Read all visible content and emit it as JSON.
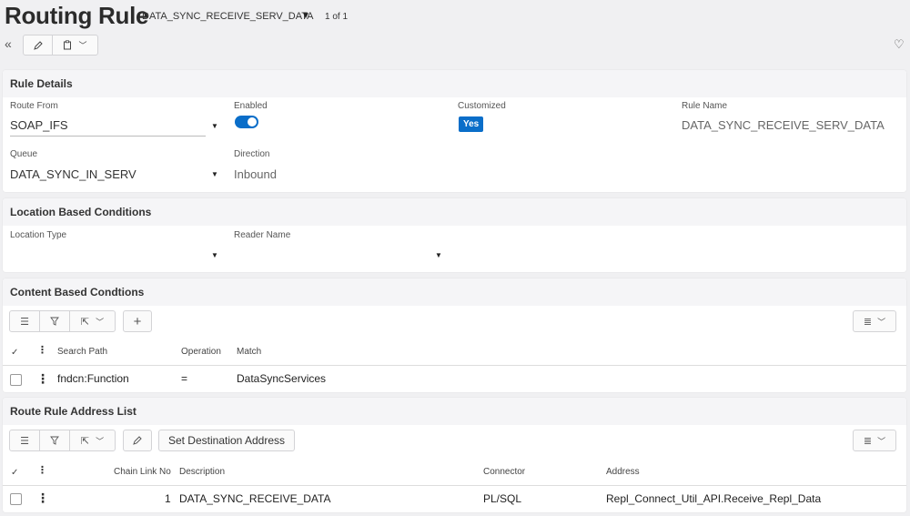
{
  "header": {
    "title": "Routing Rule",
    "record": "DATA_SYNC_RECEIVE_SERV_DATA",
    "count": "1 of 1"
  },
  "rule_details": {
    "heading": "Rule Details",
    "route_from": {
      "label": "Route From",
      "value": "SOAP_IFS"
    },
    "enabled": {
      "label": "Enabled",
      "on": true
    },
    "customized": {
      "label": "Customized",
      "value": "Yes"
    },
    "rule_name": {
      "label": "Rule Name",
      "value": "DATA_SYNC_RECEIVE_SERV_DATA"
    },
    "queue": {
      "label": "Queue",
      "value": "DATA_SYNC_IN_SERV"
    },
    "direction": {
      "label": "Direction",
      "value": "Inbound"
    }
  },
  "location_conditions": {
    "heading": "Location Based Conditions",
    "location_type_label": "Location Type",
    "reader_name_label": "Reader Name"
  },
  "content_conditions": {
    "heading": "Content Based Condtions",
    "columns": {
      "search_path": "Search Path",
      "operation": "Operation",
      "match": "Match"
    },
    "rows": [
      {
        "search_path": "fndcn:Function",
        "operation": "=",
        "match": "DataSyncServices"
      }
    ]
  },
  "address_list": {
    "heading": "Route Rule Address List",
    "set_destination_label": "Set Destination Address",
    "columns": {
      "chain_link_no": "Chain Link No",
      "description": "Description",
      "connector": "Connector",
      "address": "Address"
    },
    "rows": [
      {
        "chain_link_no": "1",
        "description": "DATA_SYNC_RECEIVE_DATA",
        "connector": "PL/SQL",
        "address": "Repl_Connect_Util_API.Receive_Repl_Data"
      }
    ]
  },
  "colors": {
    "accent": "#0a6ec9",
    "panel_header": "#f5f5f7",
    "page_bg": "#f0f0f2"
  }
}
